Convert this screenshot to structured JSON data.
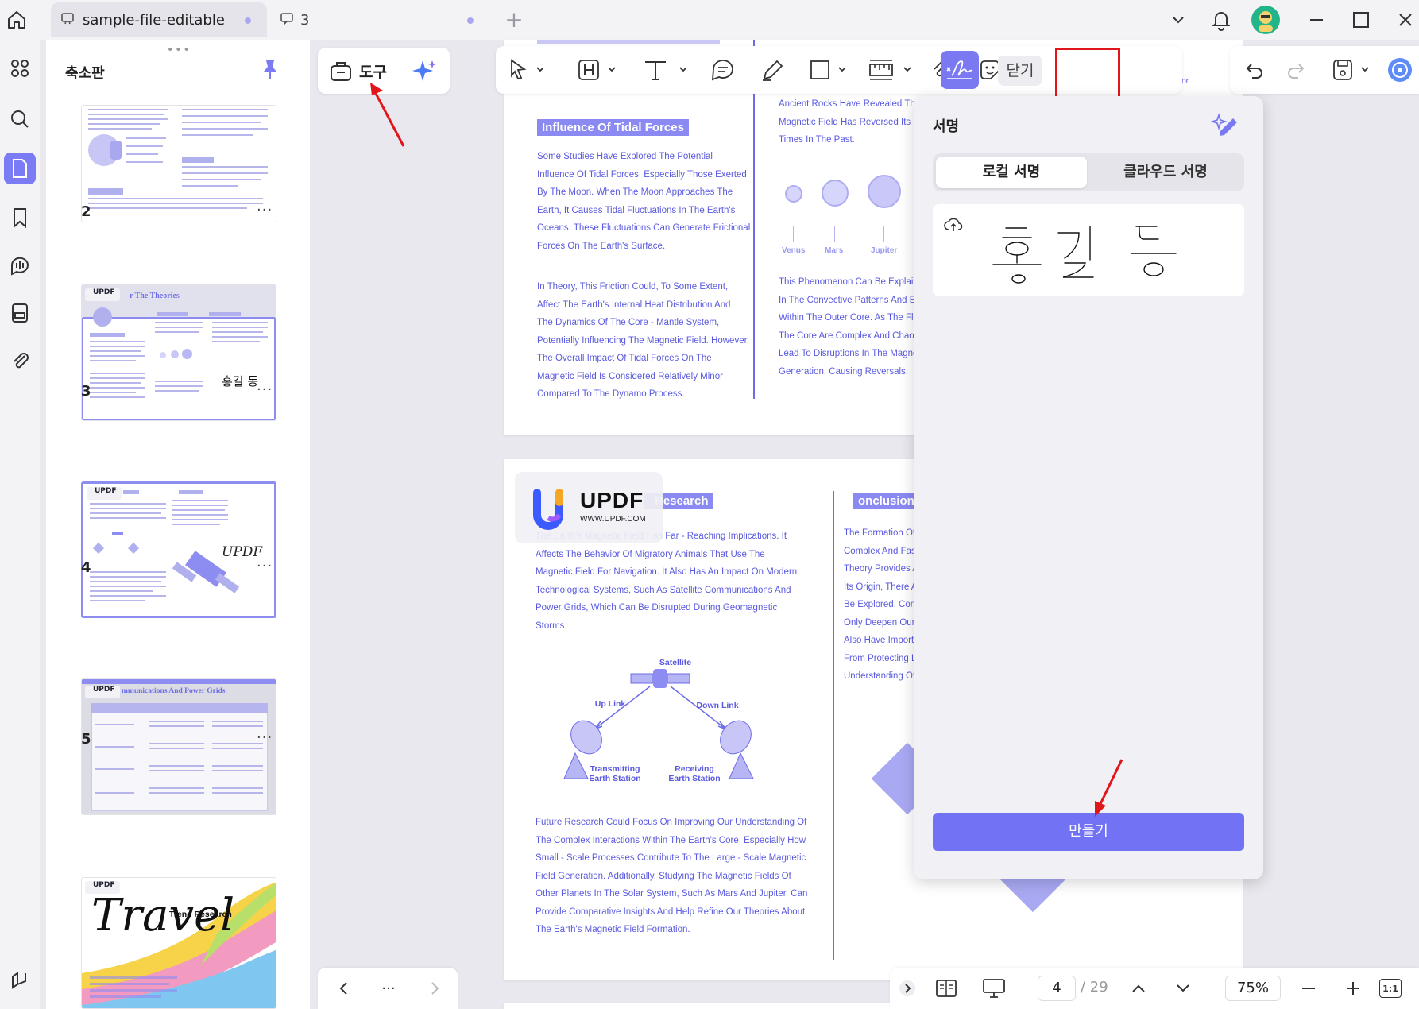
{
  "titlebar": {
    "tab_active_label": "sample-file-editable",
    "tab_comments_count": "3"
  },
  "thumbnails": {
    "title": "축소판",
    "pages": [
      {
        "num": "2",
        "more": "···"
      },
      {
        "num": "3",
        "more": "···"
      },
      {
        "num": "4",
        "more": "···"
      },
      {
        "num": "5",
        "more": "···"
      }
    ],
    "thumb3_heading": "r The Theories",
    "thumb3_sign": "홍길 동",
    "thumb4_sign": "UPDF",
    "thumb5_heading": "mmunications And Power Grids",
    "thumb6_title": "Travel",
    "thumb6_sub": "Trend Research",
    "logo_text": "UPDF"
  },
  "toolbox": {
    "label": "도구"
  },
  "maintoolbar": {
    "close_label": "닫기"
  },
  "page_top": {
    "left_badge": "Influence Of Tidal Forces",
    "left_para1": [
      "Some Studies Have Explored The Potential",
      "Influence Of Tidal Forces, Especially Those Exerted",
      "By The Moon. When The Moon Approaches The",
      "Earth, It Causes Tidal Fluctuations In The Earth's",
      "Oceans. These Fluctuations Can Generate Frictional",
      "Forces On The Earth's Surface."
    ],
    "left_para2": [
      " In Theory, This Friction Could, To Some Extent,",
      "Affect The Earth's Internal Heat Distribution And",
      "The Dynamics Of The Core - Mantle System,",
      "Potentially Influencing The Magnetic Field. However,",
      "The Overall Impact Of Tidal Forces On The",
      "Magnetic Field Is Considered Relatively Minor",
      "Compared To The Dynamo Process."
    ],
    "right_para1": [
      "Ancient Rocks Have Revealed That",
      "Magnetic Field Has Reversed Its Po",
      "Times In The Past."
    ],
    "right_para2": [
      "This Phenomenon Can Be Explained",
      "In The Convective Patterns And Elec",
      "Within The Outer Core. As The Fluid",
      "The Core Are Complex And Chaotic",
      "Lead To Disruptions In The Magneti",
      "Generation, Causing Reversals."
    ],
    "planets": [
      "Venus",
      "Mars",
      "Jupiter"
    ],
    "top_right_fragment": "erior."
  },
  "page_bottom": {
    "badge_left": "Research",
    "badge_right": "onclusion",
    "left_para1": [
      "The Earth's Magnetic Field Has Far - Reaching Implications. It",
      "Affects The Behavior Of Migratory Animals That Use The",
      "Magnetic Field For Navigation. It Also Has An Impact On Modern",
      "Technological Systems, Such As Satellite Communications And",
      "Power Grids, Which Can Be Disrupted During Geomagnetic",
      "Storms."
    ],
    "diagram": {
      "satellite": "Satellite",
      "uplink": "Up Link",
      "downlink": "Down Link",
      "transmitting": "Transmitting\nEarth Station",
      "receiving": "Receiving\nEarth Station"
    },
    "left_para2": [
      "Future Research Could Focus On Improving Our Understanding Of",
      "The Complex Interactions Within The Earth's Core, Especially How",
      "Small - Scale Processes Contribute To The Large - Scale Magnetic",
      "Field Generation. Additionally, Studying The Magnetic Fields Of",
      "Other Planets In The Solar System, Such As Mars And Jupiter, Can",
      "Provide Comparative Insights And Help Refine Our Theories About",
      "The Earth's Magnetic Field Formation."
    ],
    "right_para": [
      "The Formation Of T",
      "Complex And Fasc",
      "Theory Provides A",
      "Its Origin, There A",
      "Be Explored. Cont",
      "Only Deepen Our I",
      "Also Have Importa",
      "From Protecting Li",
      "Understanding Of"
    ],
    "watermark": {
      "brand": "UPDF",
      "url": "WWW.UPDF.COM"
    }
  },
  "signature_panel": {
    "title": "서명",
    "tab_local": "로컬 서명",
    "tab_cloud": "클라우드 서명",
    "signature_text": "홍길 동",
    "create_label": "만들기"
  },
  "statusbar": {
    "current_page": "4",
    "total_pages": "/ 29",
    "zoom": "75%",
    "fit_label": "1:1"
  },
  "pagenav": {
    "more": "···"
  },
  "colors": {
    "accent": "#7a79f2",
    "doc_text": "#5a5ae0",
    "highlight_box": "#e0161b"
  }
}
